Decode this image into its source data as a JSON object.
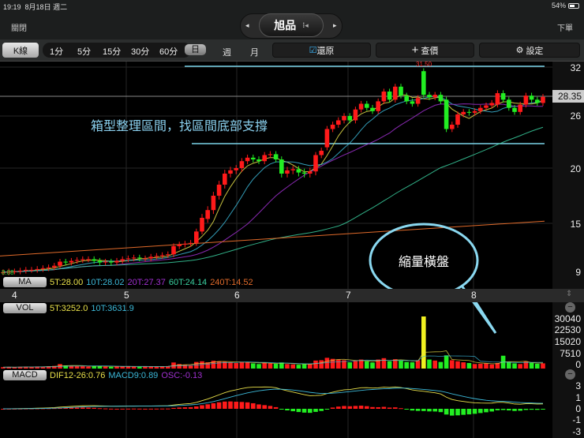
{
  "status": {
    "time": "19:19",
    "date": "8月18日 週二",
    "battery": "54%"
  },
  "nav": {
    "close": "關閉",
    "title": "旭品",
    "order": "下單",
    "prev": "◂",
    "next": "▸",
    "menu": "⁞◂"
  },
  "toolbar": {
    "kline": "K線",
    "periods": [
      "1分",
      "5分",
      "15分",
      "30分",
      "60分",
      "日",
      "週",
      "月"
    ],
    "restore": "還原",
    "price_query": "查價",
    "settings": "設定",
    "plus": "+",
    "gear": "⚙",
    "check": "☑"
  },
  "price_axis": {
    "ticks": [
      "32",
      "26",
      "20",
      "15",
      "9"
    ],
    "current": "28.35",
    "high_label": "31.50",
    "low_label": "8.88"
  },
  "months": [
    "4",
    "5",
    "6",
    "7",
    "8"
  ],
  "annotations": {
    "box_text": "箱型整理區間，找區間底部支撐",
    "bubble_text": "縮量橫盤",
    "box_top": 32,
    "box_bottom": 22.8
  },
  "ma": {
    "tag": "MA",
    "values": [
      {
        "label": "5T:28.00",
        "color": "#e8e04a"
      },
      {
        "label": "10T:28.02",
        "color": "#3cb8d8"
      },
      {
        "label": "20T:27.37",
        "color": "#a030d0"
      },
      {
        "label": "60T:24.14",
        "color": "#3ad0a0"
      },
      {
        "label": "240T:14.52",
        "color": "#e06a2a"
      }
    ]
  },
  "vol": {
    "tag": "VOL",
    "values": [
      {
        "label": "5T:3252.0",
        "color": "#e8e04a"
      },
      {
        "label": "10T:3631.9",
        "color": "#3cb8d8"
      }
    ],
    "ticks": [
      "30040",
      "22530",
      "15020",
      "7510",
      "0"
    ],
    "max": 30040
  },
  "macd": {
    "tag": "MACD",
    "values": [
      {
        "label": "DIF12-26:0.76",
        "color": "#e8e04a"
      },
      {
        "label": "MACD9:0.89",
        "color": "#3cb8d8"
      },
      {
        "label": "OSC:-0.13",
        "color": "#a030d0"
      }
    ],
    "ticks": [
      "3",
      "1",
      "0",
      "-1",
      "-3"
    ]
  },
  "colors": {
    "up": "#ff1a1a",
    "down": "#22ee22",
    "box_line": "#7ad4e8",
    "bubble": "#8ad8f0"
  },
  "chart_data": {
    "type": "candlestick",
    "closes": [
      9.0,
      9.1,
      9.1,
      9.2,
      9.3,
      9.3,
      9.4,
      9.5,
      9.6,
      9.8,
      10.3,
      10.2,
      10.4,
      10.5,
      10.6,
      10.6,
      10.4,
      10.2,
      10.3,
      10.2,
      10.4,
      10.6,
      10.7,
      10.8,
      10.7,
      10.7,
      10.9,
      11.0,
      11.1,
      11.2,
      12.2,
      12.4,
      12.5,
      12.6,
      14.0,
      15.5,
      16.2,
      17.5,
      18.5,
      19.5,
      19.8,
      20.0,
      20.8,
      21.2,
      21.0,
      20.8,
      21.5,
      21.6,
      21.0,
      19.5,
      19.8,
      19.9,
      19.6,
      19.5,
      19.7,
      21.5,
      22.0,
      24.5,
      25.0,
      25.5,
      26.0,
      25.5,
      26.8,
      27.5,
      27.0,
      26.6,
      27.8,
      29.0,
      28.0,
      29.6,
      28.5,
      27.8,
      27.5,
      28.2,
      28.6,
      28.3,
      28.6,
      27.8,
      24.5,
      25.0,
      26.2,
      26.5,
      26.4,
      26.6,
      27.0,
      27.3,
      27.6,
      28.8,
      28.0,
      27.0,
      26.5,
      27.4,
      28.5,
      28.0,
      27.6,
      28.35
    ],
    "open_overrides": {
      "57": 22.4,
      "74": 31.5,
      "78": 28.0,
      "36": 15.4,
      "87": 27.4
    },
    "volume": [
      800,
      900,
      700,
      1000,
      1100,
      900,
      1200,
      1000,
      1300,
      1500,
      2600,
      1800,
      1500,
      1400,
      1300,
      1200,
      1500,
      1400,
      1100,
      1000,
      1300,
      1200,
      1400,
      1100,
      1000,
      1200,
      1300,
      1100,
      1200,
      1400,
      3500,
      2600,
      2200,
      2000,
      3800,
      4200,
      3600,
      4500,
      4200,
      3900,
      3600,
      3200,
      3900,
      3600,
      3000,
      2600,
      3400,
      3000,
      2800,
      3500,
      2600,
      2400,
      2200,
      2500,
      2600,
      4600,
      4800,
      6200,
      5600,
      5200,
      4800,
      3600,
      4400,
      5200,
      4200,
      3500,
      5200,
      6000,
      4200,
      5400,
      4600,
      3800,
      3600,
      4800,
      30040,
      5200,
      4600,
      3800,
      7600,
      4800,
      4200,
      3600,
      3200,
      2600,
      2800,
      3000,
      2400,
      3200,
      7400,
      3800,
      3000,
      2600,
      4200,
      3400,
      2800,
      3000
    ],
    "ma240": [
      11.0,
      15.2
    ],
    "y_ticks": [
      32,
      26,
      20,
      15,
      9
    ]
  }
}
